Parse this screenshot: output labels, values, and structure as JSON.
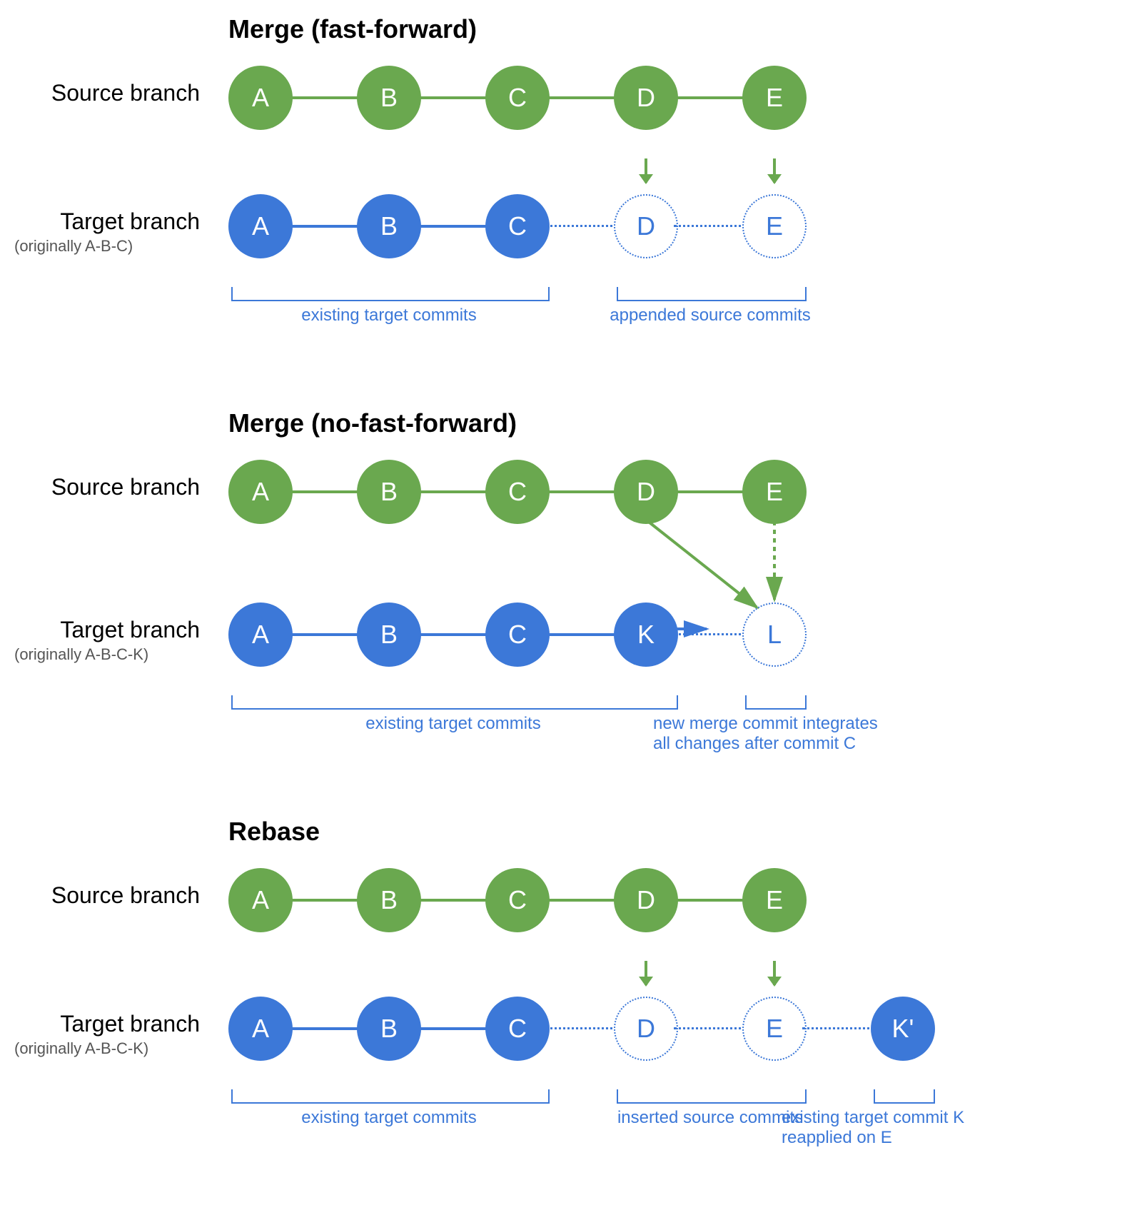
{
  "colors": {
    "green": "#6aa84f",
    "blue": "#3c78d8"
  },
  "layout": {
    "startX": 300,
    "spacing": 180,
    "commitR": 45
  },
  "sections": {
    "ff": {
      "title": "Merge (fast-forward)",
      "source_label": "Source branch",
      "target_label": "Target branch",
      "target_sublabel": "(originally A-B-C)",
      "source": [
        {
          "id": "A",
          "label": "A"
        },
        {
          "id": "B",
          "label": "B"
        },
        {
          "id": "C",
          "label": "C"
        },
        {
          "id": "D",
          "label": "D"
        },
        {
          "id": "E",
          "label": "E"
        }
      ],
      "target": [
        {
          "id": "A",
          "label": "A"
        },
        {
          "id": "B",
          "label": "B"
        },
        {
          "id": "C",
          "label": "C"
        },
        {
          "id": "D",
          "label": "D",
          "appended": true
        },
        {
          "id": "E",
          "label": "E",
          "appended": true
        }
      ],
      "brackets": [
        {
          "label": "existing target commits",
          "from": 0,
          "to": 2
        },
        {
          "label": "appended source commits",
          "from": 3,
          "to": 4
        }
      ]
    },
    "noff": {
      "title": "Merge (no-fast-forward)",
      "source_label": "Source branch",
      "target_label": "Target branch",
      "target_sublabel": "(originally A-B-C-K)",
      "source": [
        {
          "id": "A",
          "label": "A"
        },
        {
          "id": "B",
          "label": "B"
        },
        {
          "id": "C",
          "label": "C"
        },
        {
          "id": "D",
          "label": "D"
        },
        {
          "id": "E",
          "label": "E"
        }
      ],
      "target": [
        {
          "id": "A",
          "label": "A"
        },
        {
          "id": "B",
          "label": "B"
        },
        {
          "id": "C",
          "label": "C"
        },
        {
          "id": "K",
          "label": "K"
        },
        {
          "id": "L",
          "label": "L",
          "merge": true
        }
      ],
      "brackets": [
        {
          "label": "existing target commits",
          "from": 0,
          "to": 3
        },
        {
          "label": "new merge commit integrates all changes after commit C",
          "from": 4,
          "to": 4,
          "wide": true
        }
      ]
    },
    "rebase": {
      "title": "Rebase",
      "source_label": "Source branch",
      "target_label": "Target branch",
      "target_sublabel": "(originally A-B-C-K)",
      "source": [
        {
          "id": "A",
          "label": "A"
        },
        {
          "id": "B",
          "label": "B"
        },
        {
          "id": "C",
          "label": "C"
        },
        {
          "id": "D",
          "label": "D"
        },
        {
          "id": "E",
          "label": "E"
        }
      ],
      "target": [
        {
          "id": "A",
          "label": "A"
        },
        {
          "id": "B",
          "label": "B"
        },
        {
          "id": "C",
          "label": "C"
        },
        {
          "id": "D",
          "label": "D",
          "inserted": true
        },
        {
          "id": "E",
          "label": "E",
          "inserted": true
        },
        {
          "id": "Kp",
          "label": "K'"
        }
      ],
      "brackets": [
        {
          "label": "existing target commits",
          "from": 0,
          "to": 2
        },
        {
          "label": "inserted source commits",
          "from": 3,
          "to": 4
        },
        {
          "label": "existing target commit K reapplied on E",
          "from": 5,
          "to": 5,
          "wide": true
        }
      ]
    }
  }
}
